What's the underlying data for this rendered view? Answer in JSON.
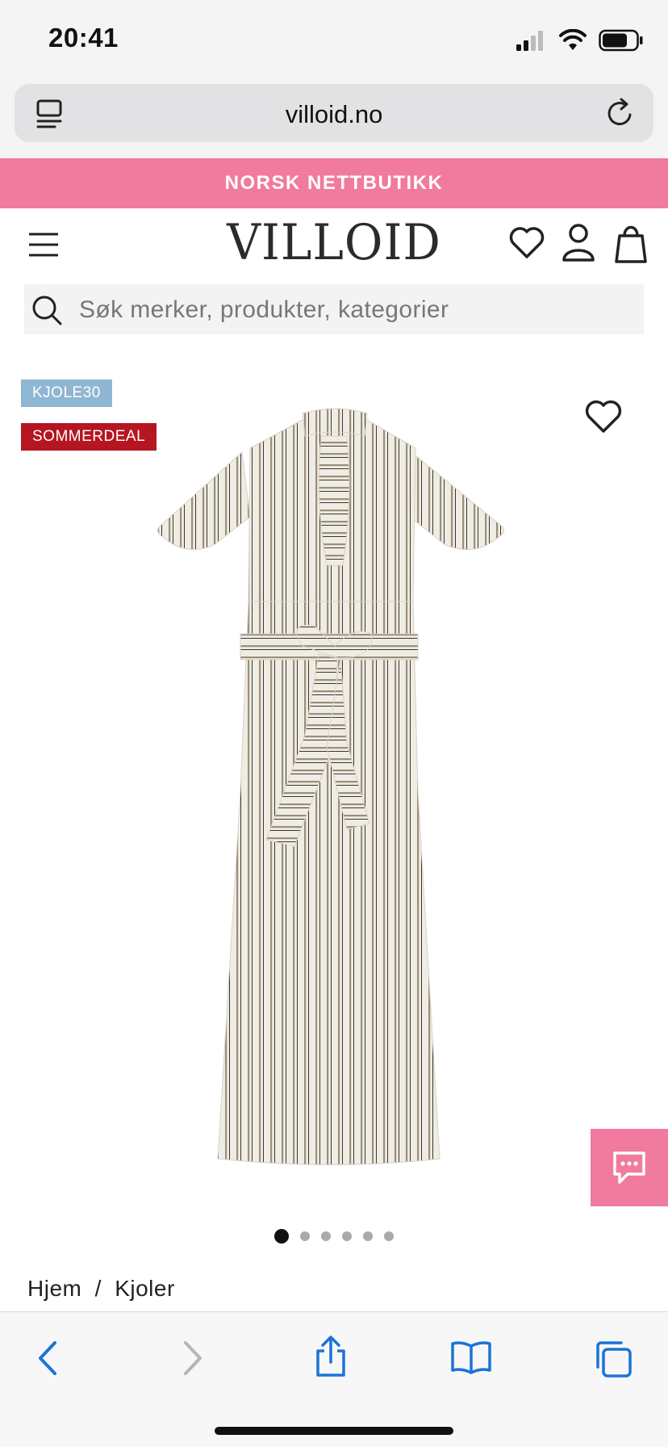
{
  "status_bar": {
    "time": "20:41"
  },
  "browser": {
    "url": "villoid.no"
  },
  "banner": {
    "text": "NORSK NETTBUTIKK"
  },
  "header": {
    "logo": "VILLOID"
  },
  "search": {
    "placeholder": "Søk merker, produkter, kategorier"
  },
  "product": {
    "badges": [
      "KJOLE30",
      "SOMMERDEAL"
    ],
    "badge_colors": [
      "#8fb6d3",
      "#b51621"
    ],
    "image": "striped-dress-photo",
    "carousel": {
      "total": 6,
      "active_index": 0
    }
  },
  "breadcrumb": {
    "home": "Hjem",
    "separator": "/",
    "category": "Kjoler"
  },
  "colors": {
    "accent": "#f07b9e",
    "safari_blue": "#1a73d9"
  },
  "toolbar": {
    "items": [
      "back-icon",
      "forward-icon",
      "share-icon",
      "bookmarks-icon",
      "tabs-icon"
    ]
  }
}
